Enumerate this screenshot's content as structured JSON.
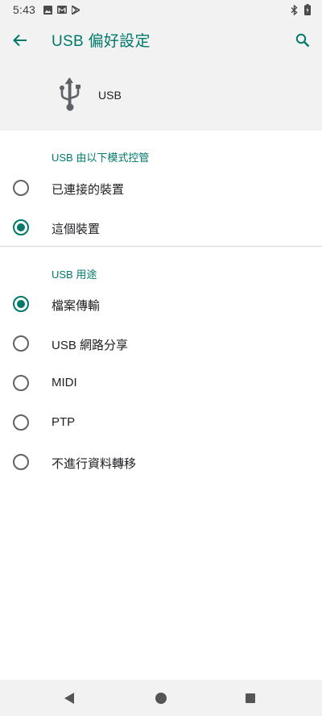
{
  "status_bar": {
    "time": "5:43",
    "notification_icons": [
      "image-icon",
      "gmail-icon",
      "play-store-icon"
    ],
    "right_icons": [
      "bluetooth-icon",
      "battery-icon"
    ]
  },
  "app_bar": {
    "title": "USB 偏好設定",
    "accent_color": "#00796b"
  },
  "header": {
    "icon": "usb-icon",
    "label": "USB"
  },
  "sections": [
    {
      "title": "USB 由以下模式控管",
      "options": [
        {
          "label": "已連接的裝置",
          "checked": false
        },
        {
          "label": "這個裝置",
          "checked": true
        }
      ]
    },
    {
      "title": "USB 用途",
      "options": [
        {
          "label": "檔案傳輸",
          "checked": true
        },
        {
          "label": "USB 網路分享",
          "checked": false
        },
        {
          "label": "MIDI",
          "checked": false
        },
        {
          "label": "PTP",
          "checked": false
        },
        {
          "label": "不進行資料轉移",
          "checked": false
        }
      ]
    }
  ],
  "nav_bar": {
    "icons": [
      "back-triangle-icon",
      "home-circle-icon",
      "recents-square-icon"
    ]
  }
}
